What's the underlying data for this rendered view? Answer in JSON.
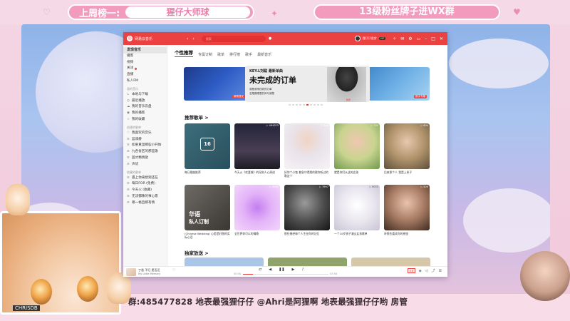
{
  "overlay": {
    "rank_title": "上周榜一:",
    "rank_name": "猩仔大师球",
    "fans_group": "13级粉丝牌子进WX群",
    "bottom_line": "群:485477828  地表最强狸仔仔  @Ahri是阿狸啊  地表最强狸仔仔哟  房管",
    "uid_tag": "CHRISDB"
  },
  "app": {
    "name": "网易云音乐",
    "search_placeholder": "搜索",
    "user_name": "狸仔仔很穷",
    "vip": "VIP",
    "sidebar": {
      "items": [
        "发现音乐",
        "播客",
        "视频",
        "关注",
        "直播",
        "私人FM"
      ],
      "my_music_head": "我的音乐",
      "my_music": [
        "本地与下载",
        "最近播放",
        "我的音乐云盘",
        "我的播客",
        "我的收藏"
      ],
      "created_head": "创建的歌单",
      "created": [
        "我喜欢的音乐",
        "蓝调爵",
        "如果重温那些小开始",
        "九各省区的那些歌",
        "固才精情歌",
        "声优"
      ],
      "collected_head": "收藏的歌单",
      "collected": [
        "遇上你来想到还在",
        "每日FOR (免费)",
        "今天火 (收藏)",
        "无法都像的事心景",
        "哪一格自那有情"
      ]
    },
    "tabs": [
      "个性推荐",
      "专属订制",
      "歌单",
      "排行榜",
      "歌手",
      "最新音乐"
    ],
    "banner": {
      "subtitle": "KEY.L刘聪   最新单曲",
      "title": "未完成的订单",
      "line1": "我是我来找你的订单",
      "line2": "总是路哪里的风与清楚",
      "exclusive": "独家",
      "left_tag": "新歌首发",
      "right_tag": "数字专辑"
    },
    "sections": {
      "recommended": "推荐歌单 >",
      "exclusive": "独家放送 >"
    },
    "playlists_row1": [
      {
        "label": "每日歌曲推荐",
        "count": "",
        "day": "16"
      },
      {
        "label": "今天火《欢喜城》的深刻人心原创",
        "count": "▷ 494323"
      },
      {
        "label": "好你个小鬼 着急守得属的歌你听过的歌这个",
        "count": "▷ 200"
      },
      {
        "label": "就是你们从这的女孩",
        "count": "▷ 700"
      },
      {
        "label": "后来那个人 我是上辈子",
        "count": "▷ 600"
      }
    ],
    "playlists_row2": [
      {
        "label": "(Chinese Wedding) 心里是好甜的实际心话",
        "count": "",
        "line1": "华语",
        "line2": "私人订制"
      },
      {
        "label": "全世界你可以的情歌",
        "count": "▷ 3000"
      },
      {
        "label": "那些曾经每个人生在你的记忆",
        "count": "▷ 7997"
      },
      {
        "label": "一个10岁孩子漫山女孩歌单",
        "count": "▷ 6000"
      },
      {
        "label": "听那些喜欢你的感觉",
        "count": "▷ 500"
      }
    ],
    "player": {
      "title": "丁香 不归 是否还",
      "artist": "My Little Memory",
      "time_current": "00:00",
      "time_total": "03:58",
      "progress": 0.12,
      "quality": "标准"
    }
  }
}
